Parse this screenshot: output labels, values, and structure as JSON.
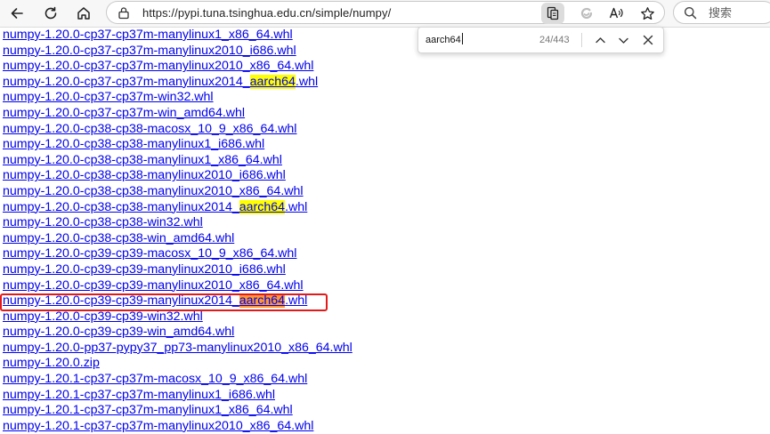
{
  "browser": {
    "url": "https://pypi.tuna.tsinghua.edu.cn/simple/numpy/",
    "search_placeholder": "搜索",
    "icons": [
      "back-icon",
      "refresh-icon",
      "home-icon",
      "lock-icon",
      "reader-view-icon",
      "tracking-prevention-icon",
      "read-aloud-icon",
      "favorite-star-icon",
      "search-icon"
    ]
  },
  "find_bar": {
    "query": "aarch64",
    "match_count": "24/443",
    "icons": [
      "chevron-up-icon",
      "chevron-down-icon",
      "close-icon"
    ]
  },
  "files": [
    {
      "pre": "numpy-1.20.0-cp37-cp37m-manylinux1_x86_64.whl"
    },
    {
      "pre": "numpy-1.20.0-cp37-cp37m-manylinux2010_i686.whl"
    },
    {
      "pre": "numpy-1.20.0-cp37-cp37m-manylinux2010_x86_64.whl"
    },
    {
      "pre": "numpy-1.20.0-cp37-cp37m-manylinux2014_",
      "match": "aarch64",
      "post": ".whl"
    },
    {
      "pre": "numpy-1.20.0-cp37-cp37m-win32.whl"
    },
    {
      "pre": "numpy-1.20.0-cp37-cp37m-win_amd64.whl"
    },
    {
      "pre": "numpy-1.20.0-cp38-cp38-macosx_10_9_x86_64.whl"
    },
    {
      "pre": "numpy-1.20.0-cp38-cp38-manylinux1_i686.whl"
    },
    {
      "pre": "numpy-1.20.0-cp38-cp38-manylinux1_x86_64.whl"
    },
    {
      "pre": "numpy-1.20.0-cp38-cp38-manylinux2010_i686.whl"
    },
    {
      "pre": "numpy-1.20.0-cp38-cp38-manylinux2010_x86_64.whl"
    },
    {
      "pre": "numpy-1.20.0-cp38-cp38-manylinux2014_",
      "match": "aarch64",
      "post": ".whl"
    },
    {
      "pre": "numpy-1.20.0-cp38-cp38-win32.whl"
    },
    {
      "pre": "numpy-1.20.0-cp38-cp38-win_amd64.whl"
    },
    {
      "pre": "numpy-1.20.0-cp39-cp39-macosx_10_9_x86_64.whl"
    },
    {
      "pre": "numpy-1.20.0-cp39-cp39-manylinux2010_i686.whl"
    },
    {
      "pre": "numpy-1.20.0-cp39-cp39-manylinux2010_x86_64.whl"
    },
    {
      "pre": "numpy-1.20.0-cp39-cp39-manylinux2014_",
      "match": "aarch64",
      "post": ".whl",
      "active": true
    },
    {
      "pre": "numpy-1.20.0-cp39-cp39-win32.whl"
    },
    {
      "pre": "numpy-1.20.0-cp39-cp39-win_amd64.whl"
    },
    {
      "pre": "numpy-1.20.0-pp37-pypy37_pp73-manylinux2010_x86_64.whl"
    },
    {
      "pre": "numpy-1.20.0.zip"
    },
    {
      "pre": "numpy-1.20.1-cp37-cp37m-macosx_10_9_x86_64.whl"
    },
    {
      "pre": "numpy-1.20.1-cp37-cp37m-manylinux1_i686.whl"
    },
    {
      "pre": "numpy-1.20.1-cp37-cp37m-manylinux1_x86_64.whl"
    },
    {
      "pre": "numpy-1.20.1-cp37-cp37m-manylinux2010_x86_64.whl"
    }
  ],
  "colors": {
    "link": "#0000ee",
    "match_highlight": "#ffff00",
    "active_match_highlight": "#ff9632",
    "annotation_box": "#e41a1a"
  }
}
